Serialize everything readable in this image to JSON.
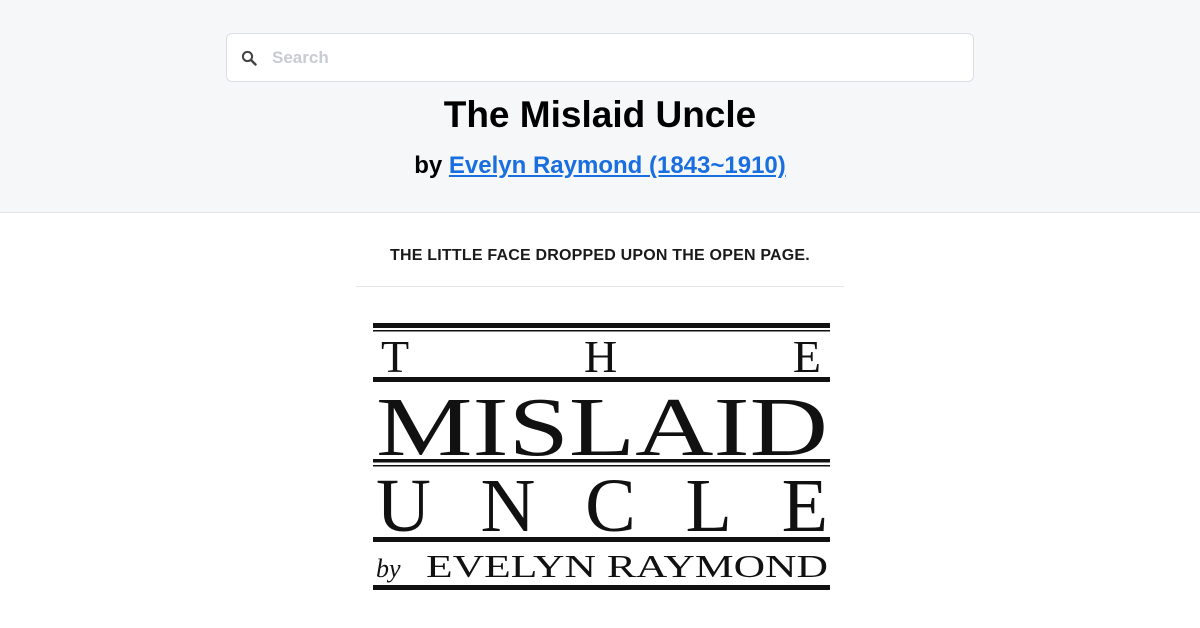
{
  "search": {
    "placeholder": "Search"
  },
  "book": {
    "title": "The Mislaid Uncle",
    "by_label": "by",
    "author_link": "Evelyn Raymond (1843~1910)"
  },
  "illustration": {
    "caption": "THE LITTLE FACE DROPPED UPON THE OPEN PAGE.",
    "cover_text": {
      "line1": "T H E",
      "line2": "MISLAID",
      "line3": "UNCLE",
      "line4_prefix": "by",
      "line4_name": "EVELYN RAYMOND"
    }
  },
  "colors": {
    "header_bg": "#f6f7f9",
    "link": "#1a6fe0",
    "ink": "#111111"
  },
  "icons": {
    "search": "search-icon"
  }
}
